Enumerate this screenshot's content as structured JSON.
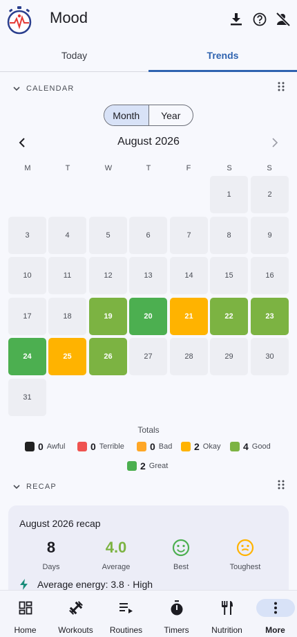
{
  "header": {
    "title": "Mood",
    "icons": [
      "app-logo-stopwatch",
      "download-icon",
      "help-icon",
      "account-off-icon"
    ]
  },
  "tabs": [
    {
      "label": "Today",
      "active": false
    },
    {
      "label": "Trends",
      "active": true
    }
  ],
  "calendar": {
    "section_label": "CALENDAR",
    "toggle": {
      "month": "Month",
      "year": "Year",
      "selected": "Month"
    },
    "month_label": "August 2026",
    "weekdays": [
      "M",
      "T",
      "W",
      "T",
      "F",
      "S",
      "S"
    ],
    "days": [
      {
        "d": "1",
        "mood": null
      },
      {
        "d": "2",
        "mood": null
      },
      {
        "d": "3",
        "mood": null
      },
      {
        "d": "4",
        "mood": null
      },
      {
        "d": "5",
        "mood": null
      },
      {
        "d": "6",
        "mood": null
      },
      {
        "d": "7",
        "mood": null
      },
      {
        "d": "8",
        "mood": null
      },
      {
        "d": "9",
        "mood": null
      },
      {
        "d": "10",
        "mood": null
      },
      {
        "d": "11",
        "mood": null
      },
      {
        "d": "12",
        "mood": null
      },
      {
        "d": "13",
        "mood": null
      },
      {
        "d": "14",
        "mood": null
      },
      {
        "d": "15",
        "mood": null
      },
      {
        "d": "16",
        "mood": null
      },
      {
        "d": "17",
        "mood": null
      },
      {
        "d": "18",
        "mood": null
      },
      {
        "d": "19",
        "mood": "good"
      },
      {
        "d": "20",
        "mood": "great"
      },
      {
        "d": "21",
        "mood": "okay"
      },
      {
        "d": "22",
        "mood": "good"
      },
      {
        "d": "23",
        "mood": "good"
      },
      {
        "d": "24",
        "mood": "great"
      },
      {
        "d": "25",
        "mood": "okay"
      },
      {
        "d": "26",
        "mood": "good"
      },
      {
        "d": "27",
        "mood": null
      },
      {
        "d": "28",
        "mood": null
      },
      {
        "d": "29",
        "mood": null
      },
      {
        "d": "30",
        "mood": null
      },
      {
        "d": "31",
        "mood": null
      }
    ],
    "first_weekday_index": 5,
    "mood_colors": {
      "awful": "#212121",
      "terrible": "#ef5350",
      "bad": "#ffa726",
      "okay": "#ffb300",
      "good": "#7cb342",
      "great": "#4caf50"
    },
    "totals": {
      "title": "Totals",
      "items": [
        {
          "count": "0",
          "label": "Awful",
          "key": "awful"
        },
        {
          "count": "0",
          "label": "Terrible",
          "key": "terrible"
        },
        {
          "count": "0",
          "label": "Bad",
          "key": "bad"
        },
        {
          "count": "2",
          "label": "Okay",
          "key": "okay"
        },
        {
          "count": "4",
          "label": "Good",
          "key": "good"
        },
        {
          "count": "2",
          "label": "Great",
          "key": "great"
        }
      ]
    }
  },
  "recap": {
    "section_label": "RECAP",
    "title": "August 2026 recap",
    "stats": [
      {
        "value": "8",
        "label": "Days"
      },
      {
        "value": "4.0",
        "label": "Average"
      },
      {
        "icon": "smile-icon",
        "label": "Best"
      },
      {
        "icon": "neutral-face-icon",
        "label": "Toughest"
      }
    ],
    "energy_text": "Average energy: 3.8 · High"
  },
  "bottom_nav": [
    {
      "label": "Home",
      "icon": "dashboard-icon",
      "active": false
    },
    {
      "label": "Workouts",
      "icon": "dumbbell-icon",
      "active": false
    },
    {
      "label": "Routines",
      "icon": "playlist-play-icon",
      "active": false
    },
    {
      "label": "Timers",
      "icon": "timer-icon",
      "active": false
    },
    {
      "label": "Nutrition",
      "icon": "fork-knife-icon",
      "active": false
    },
    {
      "label": "More",
      "icon": "more-vert-icon",
      "active": true
    }
  ],
  "colors": {
    "accent": "#2f63b0",
    "selected_bg": "#d8e2f7",
    "average_green": "#7cb342",
    "best_green": "#4caf50",
    "toughest_amber": "#ffb300"
  }
}
